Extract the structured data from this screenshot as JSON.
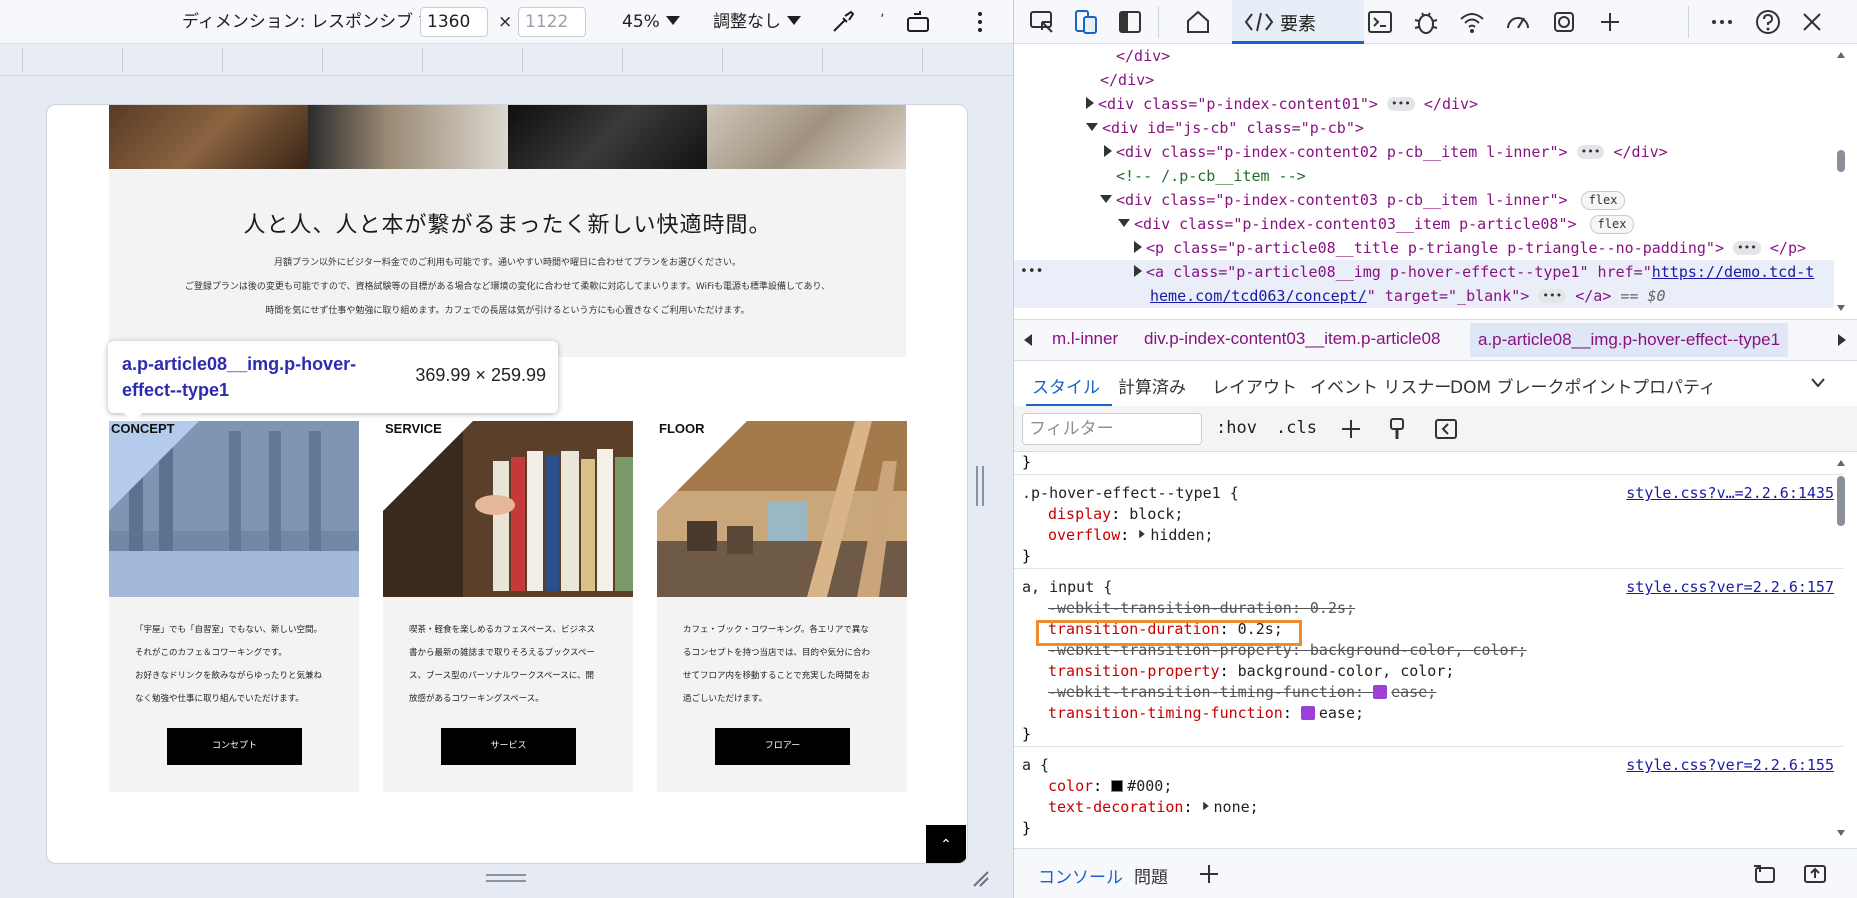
{
  "device_toolbar": {
    "dimension_label": "ディメンション: レスポンシブ",
    "width_value": "1360",
    "times": "×",
    "height_placeholder": "1122",
    "zoom": "45%",
    "throttle": "調整なし"
  },
  "page": {
    "headline": "人と人、人と本が繋がるまったく新しい快適時間。",
    "intro_lines": [
      "月額プラン以外にビジター料金でのご利用も可能です。通いやすい時間や曜日に合わせてプランをお選びください。",
      "ご登録プランは後の変更も可能ですので、資格試験等の目標がある場合など環境の変化に合わせて柔軟に対応してまいります。WiFiも電源も標準設備してあり、",
      "時間を気にせず仕事や勉強に取り組めます。カフェでの長居は気が引けるという方にも心置きなくご利用いただけます。"
    ],
    "cards": [
      {
        "label": "CONCEPT",
        "lines": [
          "「宇屋」でも「自習室」でもない、新しい空間。",
          "それがこのカフェ＆コワーキングです。",
          "お好きなドリンクを飲みながらゆったりと気兼ね",
          "なく勉強や仕事に取り組んでいただけます。"
        ],
        "button": "コンセプト"
      },
      {
        "label": "SERVICE",
        "lines": [
          "喫茶・軽食を楽しめるカフェスペース、ビジネス",
          "書から最新の雑誌まで取りそろえるブックスペー",
          "ス、ブース型のパーソナルワークスペースに、開",
          "放感があるコワーキングスペース。"
        ],
        "button": "サービス"
      },
      {
        "label": "FLOOR",
        "lines": [
          "カフェ・ブック・コワーキング。各エリアで異な",
          "るコンセプトを持つ当店では、目的や気分に合わ",
          "せてフロア内を移動することで充実した時間をお",
          "過ごしいただけます。"
        ],
        "button": "フロアー"
      }
    ],
    "scroll_top": "⌃"
  },
  "tooltip": {
    "name": "a.p-article08__img.p-hover-effect--type1",
    "size": "369.99 × 259.99"
  },
  "devtools": {
    "elements_tab": "要素",
    "dom": {
      "close_div1": "</div>",
      "close_div2": "</div>",
      "line_content01_open": "<div class=\"p-index-content01\">",
      "line_content01_close": "</div>",
      "cb_open": "<div id=\"js-cb\" class=\"p-cb\">",
      "content02_open": "<div class=\"p-index-content02 p-cb__item l-inner\">",
      "content02_close": "</div>",
      "comment": "<!-- /.p-cb__item -->",
      "content03_open": "<div class=\"p-index-content03 p-cb__item l-inner\">",
      "flex_badge": "flex",
      "item_open": "<div class=\"p-index-content03__item p-article08\">",
      "p_open": "<p class=\"p-article08__title p-triangle p-triangle--no-padding\">",
      "p_close": "</p>",
      "a_open_1": "<a class=\"p-article08__img p-hover-effect--type1\" href=\"",
      "a_href_1": "https://demo.tcd-t",
      "a_href_2": "heme.com/tcd063/concept/",
      "a_target": "\" target=\"_blank\">",
      "a_close": "</a>",
      "a_eq": "== $0",
      "dots": "•••"
    },
    "breadcrumbs": [
      "m.l-inner",
      "div.p-index-content03__item.p-article08",
      "a.p-article08__img.p-hover-effect--type1"
    ],
    "subtabs": [
      "スタイル",
      "計算済み",
      "レイアウト",
      "イベント リスナー",
      "DOM ブレークポイント",
      "プロパティ"
    ],
    "filter_placeholder": "フィルター",
    "hov": ":hov",
    "cls": ".cls",
    "styles": {
      "rule0_close": "}",
      "rule1_selector": ".p-hover-effect--type1 {",
      "rule1_src": "style.css?v…=2.2.6:1435",
      "rule1_props": [
        {
          "name": "display",
          "value": "block;"
        },
        {
          "name": "overflow",
          "value": "hidden;"
        }
      ],
      "rule1_close": "}",
      "rule2_selector": "a, input {",
      "rule2_src": "style.css?ver=2.2.6:157",
      "rule2_props": [
        {
          "name": "-webkit-transition-duration",
          "value": "0.2s;",
          "strike": true
        },
        {
          "name": "transition-duration",
          "value": "0.2s;",
          "strike": false
        },
        {
          "name": "-webkit-transition-property",
          "value": "background-color, color;",
          "strike": true
        },
        {
          "name": "transition-property",
          "value": "background-color, color;",
          "strike": false
        },
        {
          "name": "-webkit-transition-timing-function",
          "value": "ease;",
          "strike": true
        },
        {
          "name": "transition-timing-function",
          "value": "ease;",
          "strike": false
        }
      ],
      "rule2_close": "}",
      "rule3_selector": "a {",
      "rule3_src": "style.css?ver=2.2.6:155",
      "rule3_props": [
        {
          "name": "color",
          "value": "#000;"
        },
        {
          "name": "text-decoration",
          "value": "none;"
        }
      ],
      "rule3_close": "}"
    },
    "drawer": [
      "コンソール",
      "問題"
    ]
  },
  "colors": {
    "accent": "#1a64c8",
    "highlight": "#f08a2e",
    "tag": "#881280"
  }
}
